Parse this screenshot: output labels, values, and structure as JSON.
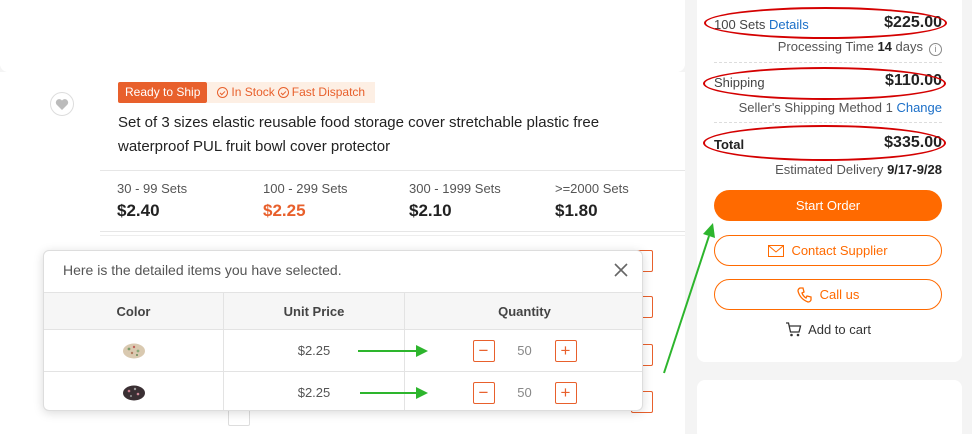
{
  "product": {
    "badge_ready": "Ready to Ship",
    "badge_stock": "In Stock",
    "badge_dispatch": "Fast Dispatch",
    "title": "Set of 3 sizes elastic reusable food storage cover stretchable plastic free waterproof PUL fruit bowl cover protector",
    "tiers": [
      {
        "qty": "30 - 99 Sets",
        "price": "$2.40",
        "active": false
      },
      {
        "qty": "100 - 299 Sets",
        "price": "$2.25",
        "active": true
      },
      {
        "qty": "300 - 1999 Sets",
        "price": "$2.10",
        "active": false
      },
      {
        "qty": ">=2000 Sets",
        "price": "$1.80",
        "active": false
      }
    ]
  },
  "summary": {
    "sets_label": "100 Sets",
    "details_link": "Details",
    "sets_price": "$225.00",
    "processing_label": "Processing Time",
    "processing_value": "14",
    "processing_unit": "days",
    "shipping_label": "Shipping",
    "shipping_price": "$110.00",
    "shipping_method": "Seller's Shipping Method 1",
    "change_link": "Change",
    "total_label": "Total",
    "total_price": "$335.00",
    "delivery_label": "Estimated Delivery",
    "delivery_value": "9/17-9/28",
    "start_order": "Start Order",
    "contact_supplier": "Contact Supplier",
    "call_us": "Call us",
    "add_to_cart": "Add to cart"
  },
  "popup": {
    "heading": "Here is the detailed items you have selected.",
    "columns": [
      "Color",
      "Unit Price",
      "Quantity"
    ],
    "rows": [
      {
        "unit_price": "$2.25",
        "quantity": "50",
        "swatch": "#d9c9b0"
      },
      {
        "unit_price": "$2.25",
        "quantity": "50",
        "swatch": "#3a2f33"
      }
    ]
  },
  "colors": {
    "accent": "#ff6a00",
    "annotation_red": "#d40000",
    "annotation_green": "#2db52d",
    "link": "#1b6fc8"
  }
}
